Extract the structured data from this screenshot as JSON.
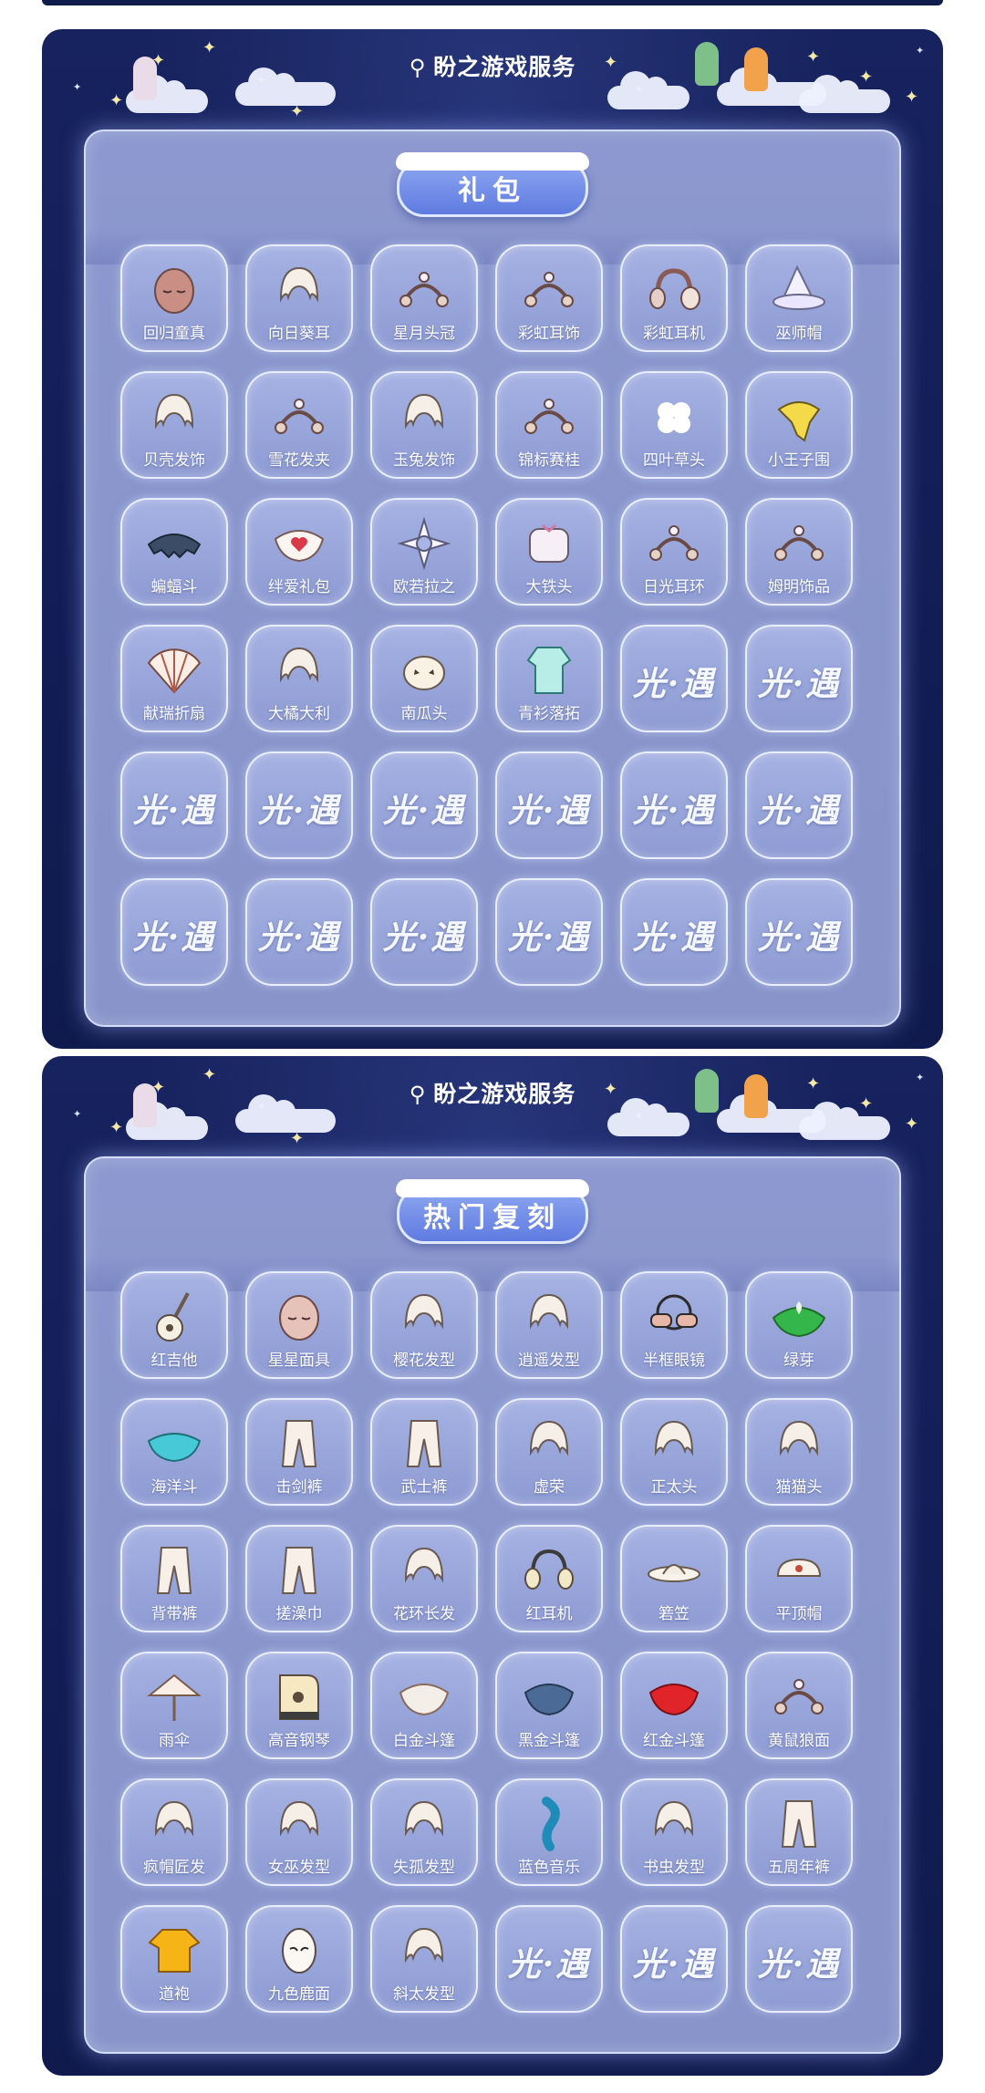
{
  "brand": {
    "name": "盼之游戏服务"
  },
  "placeholder_mark": "光·遇",
  "panels": [
    {
      "title": "礼包",
      "items": [
        {
          "label": "回归童真",
          "icon": "mask-icon"
        },
        {
          "label": "向日葵耳",
          "icon": "sunflower-headband-icon"
        },
        {
          "label": "星月头冠",
          "icon": "star-moon-crown-icon"
        },
        {
          "label": "彩虹耳饰",
          "icon": "rainbow-earring-icon"
        },
        {
          "label": "彩虹耳机",
          "icon": "headphones-icon"
        },
        {
          "label": "巫师帽",
          "icon": "wizard-hat-icon"
        },
        {
          "label": "贝壳发饰",
          "icon": "shell-hairpiece-icon"
        },
        {
          "label": "雪花发夹",
          "icon": "snowflake-clip-icon"
        },
        {
          "label": "玉兔发饰",
          "icon": "rabbit-hairpiece-icon"
        },
        {
          "label": "锦标赛桂",
          "icon": "laurel-icon"
        },
        {
          "label": "四叶草头",
          "icon": "clover-icon"
        },
        {
          "label": "小王子围",
          "icon": "scarf-icon"
        },
        {
          "label": "蝙蝠斗",
          "icon": "bat-cape-icon"
        },
        {
          "label": "绊爱礼包",
          "icon": "heart-cape-icon"
        },
        {
          "label": "欧若拉之",
          "icon": "aurora-star-icon"
        },
        {
          "label": "大铁头",
          "icon": "tv-head-icon"
        },
        {
          "label": "日光耳环",
          "icon": "sun-earring-icon"
        },
        {
          "label": "姆明饰品",
          "icon": "moomin-accessory-icon"
        },
        {
          "label": "献瑞折扇",
          "icon": "folding-fan-icon"
        },
        {
          "label": "大橘大利",
          "icon": "orange-hairpiece-icon"
        },
        {
          "label": "南瓜头",
          "icon": "pumpkin-head-icon"
        },
        {
          "label": "青衫落拓",
          "icon": "green-robe-icon"
        },
        {
          "placeholder": true
        },
        {
          "placeholder": true
        },
        {
          "placeholder": true
        },
        {
          "placeholder": true
        },
        {
          "placeholder": true
        },
        {
          "placeholder": true
        },
        {
          "placeholder": true
        },
        {
          "placeholder": true
        },
        {
          "placeholder": true
        },
        {
          "placeholder": true
        },
        {
          "placeholder": true
        },
        {
          "placeholder": true
        },
        {
          "placeholder": true
        },
        {
          "placeholder": true
        }
      ]
    },
    {
      "title": "热门复刻",
      "items": [
        {
          "label": "红吉他",
          "icon": "guitar-icon"
        },
        {
          "label": "星星面具",
          "icon": "star-mask-icon"
        },
        {
          "label": "樱花发型",
          "icon": "sakura-hair-icon"
        },
        {
          "label": "逍遥发型",
          "icon": "ponytail-hair-icon"
        },
        {
          "label": "半框眼镜",
          "icon": "glasses-icon"
        },
        {
          "label": "绿芽",
          "icon": "green-sprout-cape-icon"
        },
        {
          "label": "海洋斗",
          "icon": "ocean-cape-icon"
        },
        {
          "label": "击剑裤",
          "icon": "fencing-pants-icon"
        },
        {
          "label": "武士裤",
          "icon": "samurai-pants-icon"
        },
        {
          "label": "虚荣",
          "icon": "curly-hair-icon"
        },
        {
          "label": "正太头",
          "icon": "short-hair-icon"
        },
        {
          "label": "猫猫头",
          "icon": "cat-hair-icon"
        },
        {
          "label": "背带裤",
          "icon": "overalls-icon"
        },
        {
          "label": "搓澡巾",
          "icon": "bath-pants-icon"
        },
        {
          "label": "花环长发",
          "icon": "flower-crown-hair-icon"
        },
        {
          "label": "红耳机",
          "icon": "red-headphones-icon"
        },
        {
          "label": "箬笠",
          "icon": "straw-hat-icon"
        },
        {
          "label": "平顶帽",
          "icon": "flat-cap-icon"
        },
        {
          "label": "雨伞",
          "icon": "umbrella-icon"
        },
        {
          "label": "高音钢琴",
          "icon": "piano-icon"
        },
        {
          "label": "白金斗篷",
          "icon": "white-gold-cape-icon"
        },
        {
          "label": "黑金斗篷",
          "icon": "black-gold-cape-icon"
        },
        {
          "label": "红金斗篷",
          "icon": "red-gold-cape-icon"
        },
        {
          "label": "黄鼠狼面",
          "icon": "weasel-mask-icon"
        },
        {
          "label": "疯帽匠发",
          "icon": "mad-hatter-hair-icon"
        },
        {
          "label": "女巫发型",
          "icon": "witch-hair-icon"
        },
        {
          "label": "失孤发型",
          "icon": "wild-hair-icon"
        },
        {
          "label": "蓝色音乐",
          "icon": "blue-music-icon"
        },
        {
          "label": "书虫发型",
          "icon": "bookworm-hair-icon"
        },
        {
          "label": "五周年裤",
          "icon": "anniversary-pants-icon"
        },
        {
          "label": "道袍",
          "icon": "taoist-robe-icon"
        },
        {
          "label": "九色鹿面",
          "icon": "deer-mask-icon"
        },
        {
          "label": "斜太发型",
          "icon": "side-hair-icon"
        },
        {
          "placeholder": true
        },
        {
          "placeholder": true
        },
        {
          "placeholder": true
        }
      ]
    }
  ]
}
